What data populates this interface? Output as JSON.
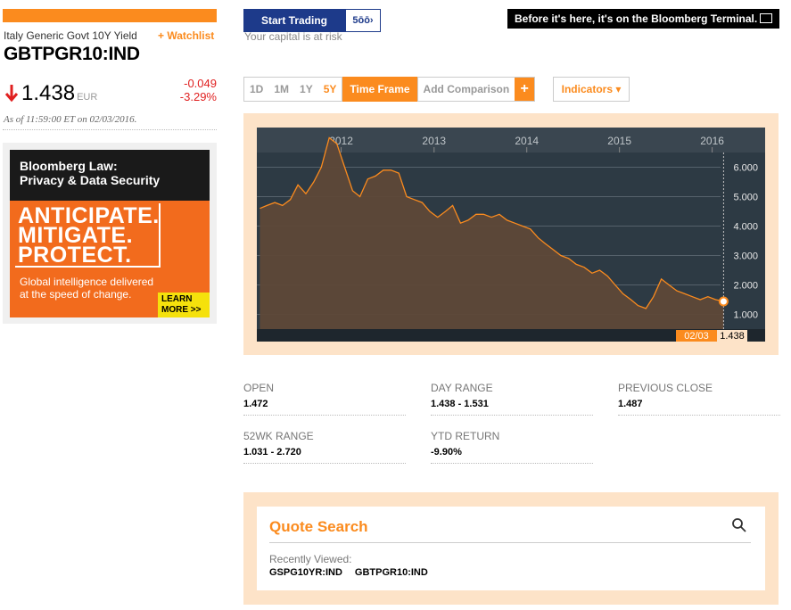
{
  "quote": {
    "name": "Italy Generic Govt 10Y Yield",
    "watchlist": "+ Watchlist",
    "ticker": "GBTPGR10:IND",
    "price": "1.438",
    "currency": "EUR",
    "change": "-0.049",
    "change_pct": "-3.29%",
    "as_of": "As of 11:59:00 ET on 02/03/2016."
  },
  "ad": {
    "title_line1": "Bloomberg Law:",
    "title_line2": "Privacy & Data Security",
    "big1": "ANTICIPATE.",
    "big2": "MITIGATE.",
    "big3": "PROTECT.",
    "sub1": "Global intelligence delivered",
    "sub2": "at the speed of change.",
    "learn1": "LEARN",
    "learn2": "MORE >>"
  },
  "banner": {
    "start_trading": "Start Trading",
    "logo": "5ōō›",
    "risk": "Your capital is at risk",
    "terminal": "Before it's here, it's on the Bloomberg Terminal."
  },
  "controls": {
    "ranges": [
      "1D",
      "1M",
      "1Y",
      "5Y"
    ],
    "active_range": "5Y",
    "time_frame": "Time Frame",
    "add_comparison": "Add Comparison",
    "plus": "+",
    "indicators": "Indicators ▾"
  },
  "colors": {
    "accent": "#fb8b1e",
    "negative": "#e02020",
    "chart_bg": "#2d3a44",
    "panel_bg": "#fde3c8"
  },
  "chart_data": {
    "type": "area",
    "x_ticks": [
      "2012",
      "2013",
      "2014",
      "2015",
      "2016"
    ],
    "y_ticks": [
      "6.000",
      "5.000",
      "4.000",
      "3.000",
      "2.000",
      "1.000"
    ],
    "ylim": [
      0.5,
      6.5
    ],
    "xlim": [
      "2011-02-03",
      "2016-02-03"
    ],
    "last_label_date": "02/03",
    "last_label_value": "1.438",
    "series": [
      {
        "x": [
          "2011-02",
          "2011-03",
          "2011-04",
          "2011-05",
          "2011-06",
          "2011-07",
          "2011-08",
          "2011-09",
          "2011-10",
          "2011-11",
          "2011-12",
          "2012-01",
          "2012-02",
          "2012-03",
          "2012-04",
          "2012-05",
          "2012-06",
          "2012-07",
          "2012-08",
          "2012-09",
          "2012-10",
          "2012-11",
          "2012-12",
          "2013-01",
          "2013-02",
          "2013-03",
          "2013-04",
          "2013-05",
          "2013-06",
          "2013-07",
          "2013-08",
          "2013-09",
          "2013-10",
          "2013-11",
          "2013-12",
          "2014-01",
          "2014-02",
          "2014-03",
          "2014-04",
          "2014-05",
          "2014-06",
          "2014-07",
          "2014-08",
          "2014-09",
          "2014-10",
          "2014-11",
          "2014-12",
          "2015-01",
          "2015-02",
          "2015-03",
          "2015-04",
          "2015-05",
          "2015-06",
          "2015-07",
          "2015-08",
          "2015-09",
          "2015-10",
          "2015-11",
          "2015-12",
          "2016-01",
          "2016-02"
        ],
        "values": [
          4.6,
          4.7,
          4.8,
          4.7,
          4.9,
          5.4,
          5.1,
          5.5,
          6.0,
          7.0,
          6.8,
          6.0,
          5.2,
          5.0,
          5.6,
          5.7,
          5.9,
          5.9,
          5.8,
          5.0,
          4.9,
          4.8,
          4.5,
          4.3,
          4.5,
          4.7,
          4.1,
          4.2,
          4.4,
          4.4,
          4.3,
          4.4,
          4.2,
          4.1,
          4.0,
          3.9,
          3.6,
          3.4,
          3.2,
          3.0,
          2.9,
          2.7,
          2.6,
          2.4,
          2.5,
          2.3,
          2.0,
          1.7,
          1.5,
          1.3,
          1.2,
          1.6,
          2.2,
          2.0,
          1.8,
          1.7,
          1.6,
          1.5,
          1.6,
          1.5,
          1.438
        ]
      }
    ]
  },
  "stats": {
    "open_label": "OPEN",
    "open_value": "1.472",
    "day_range_label": "DAY RANGE",
    "day_range_value": "1.438 - 1.531",
    "prev_close_label": "PREVIOUS CLOSE",
    "prev_close_value": "1.487",
    "wk52_label": "52WK RANGE",
    "wk52_value": "1.031 - 2.720",
    "ytd_label": "YTD RETURN",
    "ytd_value": "-9.90%"
  },
  "quote_search": {
    "title": "Quote Search",
    "recently_viewed": "Recently Viewed:",
    "items": [
      "GSPG10YR:IND",
      "GBTPGR10:IND"
    ]
  }
}
